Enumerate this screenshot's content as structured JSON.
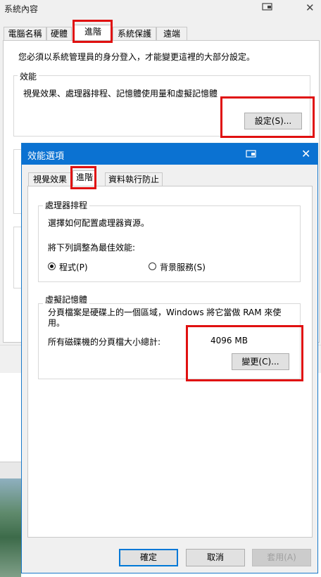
{
  "system_window": {
    "title": "系統內容",
    "tabs": [
      "電腦名稱",
      "硬體",
      "進階",
      "系統保護",
      "遠端"
    ],
    "admin_note": "您必須以系統管理員的身分登入，才能變更這裡的大部分設定。",
    "performance_group": {
      "label": "效能",
      "description": "視覺效果、處理器排程、記憶體使用量和虛擬記憶體",
      "settings_button": "設定(S)..."
    }
  },
  "dialog": {
    "title": "效能選項",
    "tabs": [
      "視覺效果",
      "進階",
      "資料執行防止"
    ],
    "processor_group": {
      "label": "處理器排程",
      "description": "選擇如何配置處理器資源。",
      "adjust_label": "將下列調整為最佳效能:",
      "options": [
        "程式(P)",
        "背景服務(S)"
      ],
      "selected": "程式(P)"
    },
    "virtual_memory_group": {
      "label": "虛擬記憶體",
      "description": "分頁檔案是硬碟上的一個區域，Windows 將它當做 RAM 來使用。",
      "total_label": "所有磁碟機的分頁檔大小總計:",
      "total_value": "4096 MB",
      "change_button": "變更(C)..."
    },
    "buttons": {
      "ok": "確定",
      "cancel": "取消",
      "apply": "套用(A)"
    }
  },
  "colors": {
    "titlebar": "#0b72d2",
    "highlight": "#e01010",
    "default_button_border": "#0078d7"
  }
}
